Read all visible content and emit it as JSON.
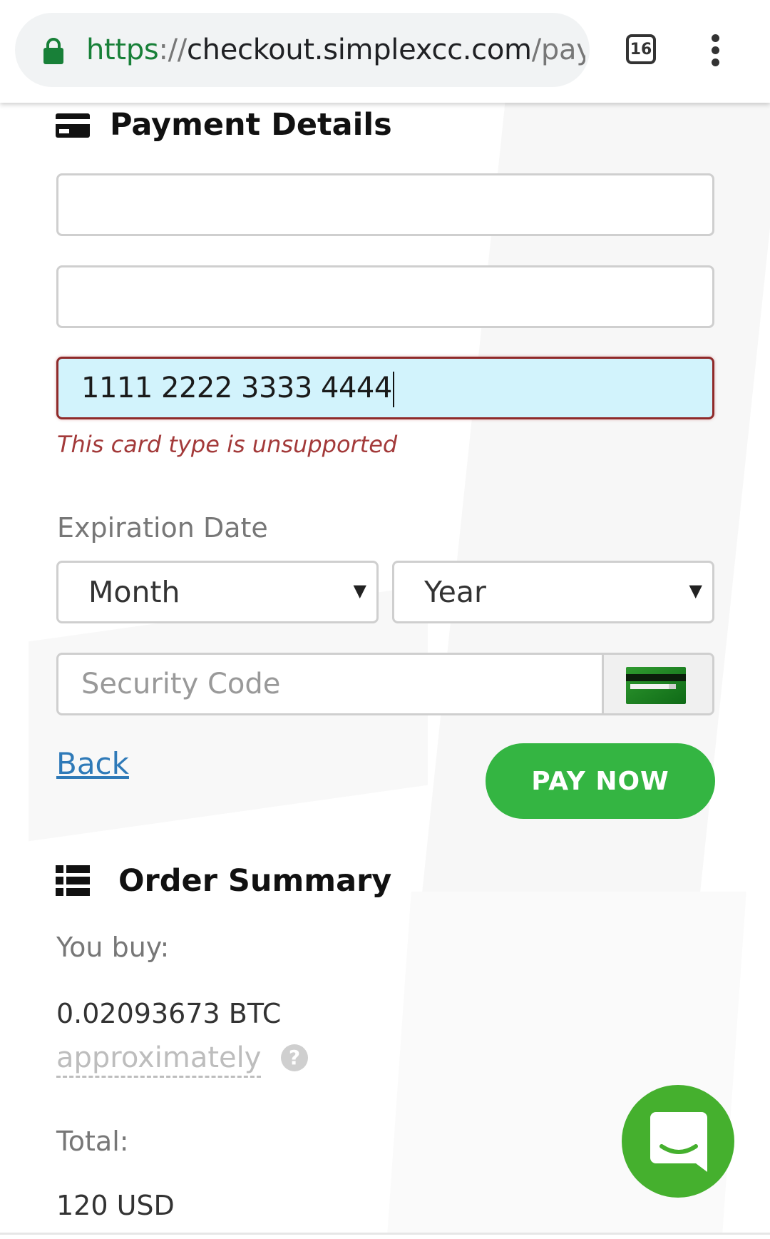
{
  "browser": {
    "url_scheme": "https",
    "url_separator": "://",
    "url_host": "checkout.simplexcc.com",
    "url_path": "/pay",
    "tab_count": "16"
  },
  "payment": {
    "title": "Payment Details",
    "card_number_value": "1111 2222 3333 4444",
    "card_error": "This card type is unsupported",
    "expiration_label": "Expiration Date",
    "month_placeholder": "Month",
    "year_placeholder": "Year",
    "security_placeholder": "Security Code",
    "back_label": "Back",
    "pay_label": "PAY NOW"
  },
  "order": {
    "title": "Order Summary",
    "you_buy_label": "You buy:",
    "amount": "0.02093673 BTC",
    "approximately": "approximately",
    "help": "?",
    "total_label": "Total:",
    "total_value": "120 USD"
  },
  "colors": {
    "accent_green": "#34b542",
    "error_red": "#a33a3a",
    "link_blue": "#2f7ab8",
    "card_field_bg": "#d2f3fc"
  },
  "icons": [
    "lock-icon",
    "tab-switcher",
    "more-vert-icon",
    "credit-card-icon",
    "list-icon",
    "cvv-card-icon",
    "help-icon",
    "chat-icon"
  ]
}
